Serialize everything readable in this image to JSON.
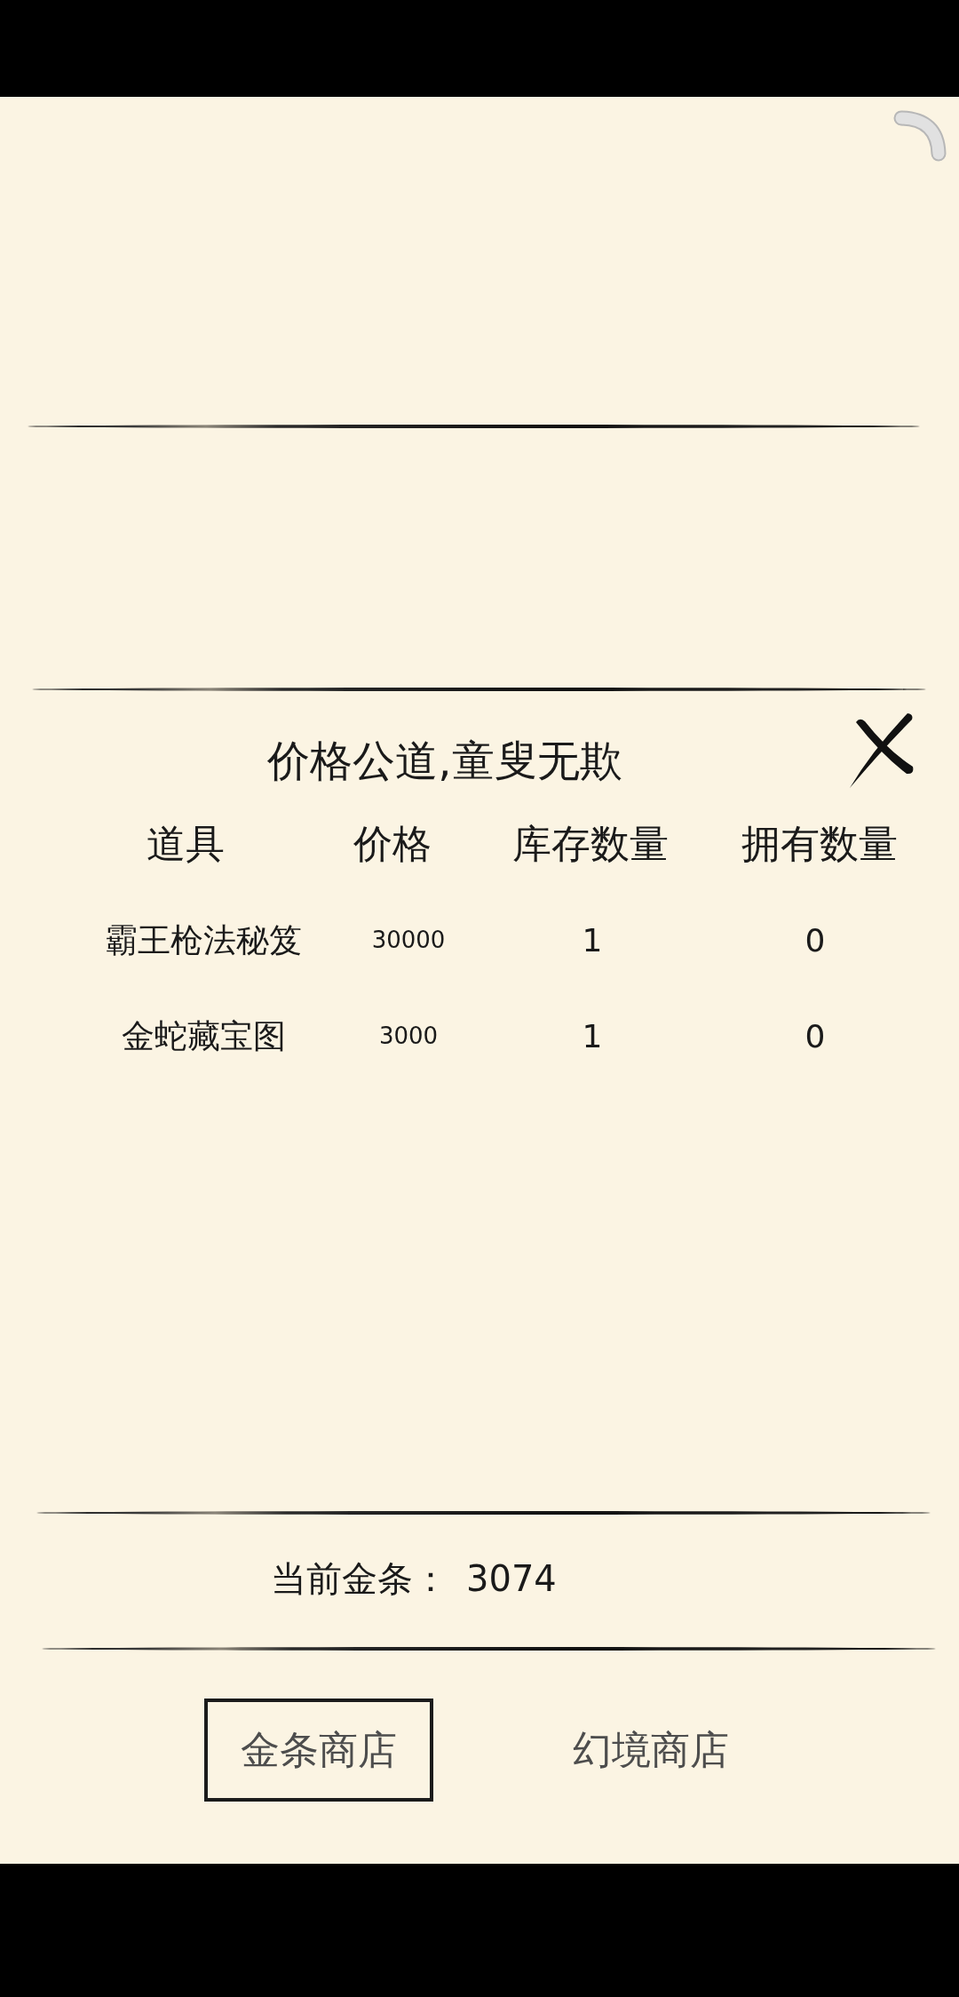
{
  "title": "价格公道,童叟无欺",
  "table": {
    "columns": [
      "道具",
      "价格",
      "库存数量",
      "拥有数量"
    ],
    "rows": [
      {
        "item": "霸王枪法秘笈",
        "price": "30000",
        "stock": "1",
        "owned": "0"
      },
      {
        "item": "金蛇藏宝图",
        "price": "3000",
        "stock": "1",
        "owned": "0"
      }
    ]
  },
  "balance": {
    "label": "当前金条：",
    "value": "3074"
  },
  "tabs": [
    {
      "label": "金条商店",
      "selected": true
    },
    {
      "label": "幻境商店",
      "selected": false
    }
  ]
}
